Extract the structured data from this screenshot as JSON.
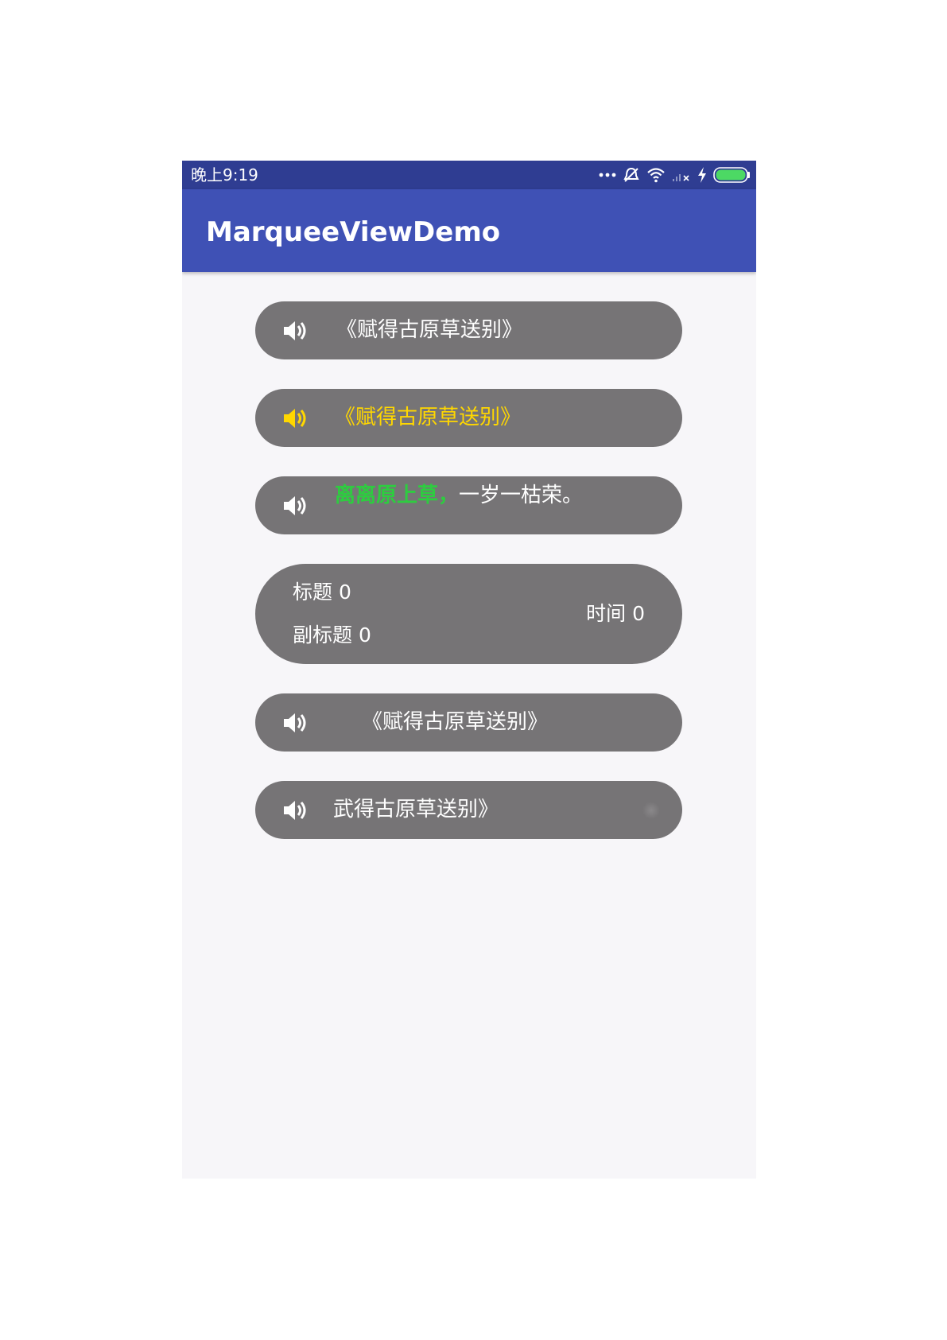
{
  "status_bar": {
    "time": "晚上9:19",
    "icons": [
      "more-dots-icon",
      "alarm-off-icon",
      "wifi-icon",
      "signal-off-icon",
      "charging-bolt-icon",
      "battery-icon"
    ],
    "battery_color": "#4cd964"
  },
  "app_bar": {
    "title": "MarqueeViewDemo",
    "color": "#3f51b5"
  },
  "marquees": [
    {
      "text": "《赋得古原草送别》",
      "icon": "speaker-icon"
    },
    {
      "text": "《赋得古原草送别》",
      "icon": "speaker-icon",
      "text_color": "#ffd700"
    },
    {
      "text_green": "离离原上草，",
      "text_white": "一岁一枯荣。",
      "icon": "speaker-icon",
      "green_color": "#2ecc40"
    },
    {
      "title": "标题 0",
      "subtitle": "副标题 0",
      "time": "时间 0"
    },
    {
      "text": "《赋得古原草送别》",
      "icon": "speaker-icon"
    },
    {
      "text": "武得古原草送别》",
      "icon": "speaker-icon"
    }
  ],
  "colors": {
    "pill_background": "#767476",
    "page_background": "#f7f6f9",
    "status_bar": "#2f3d92"
  }
}
